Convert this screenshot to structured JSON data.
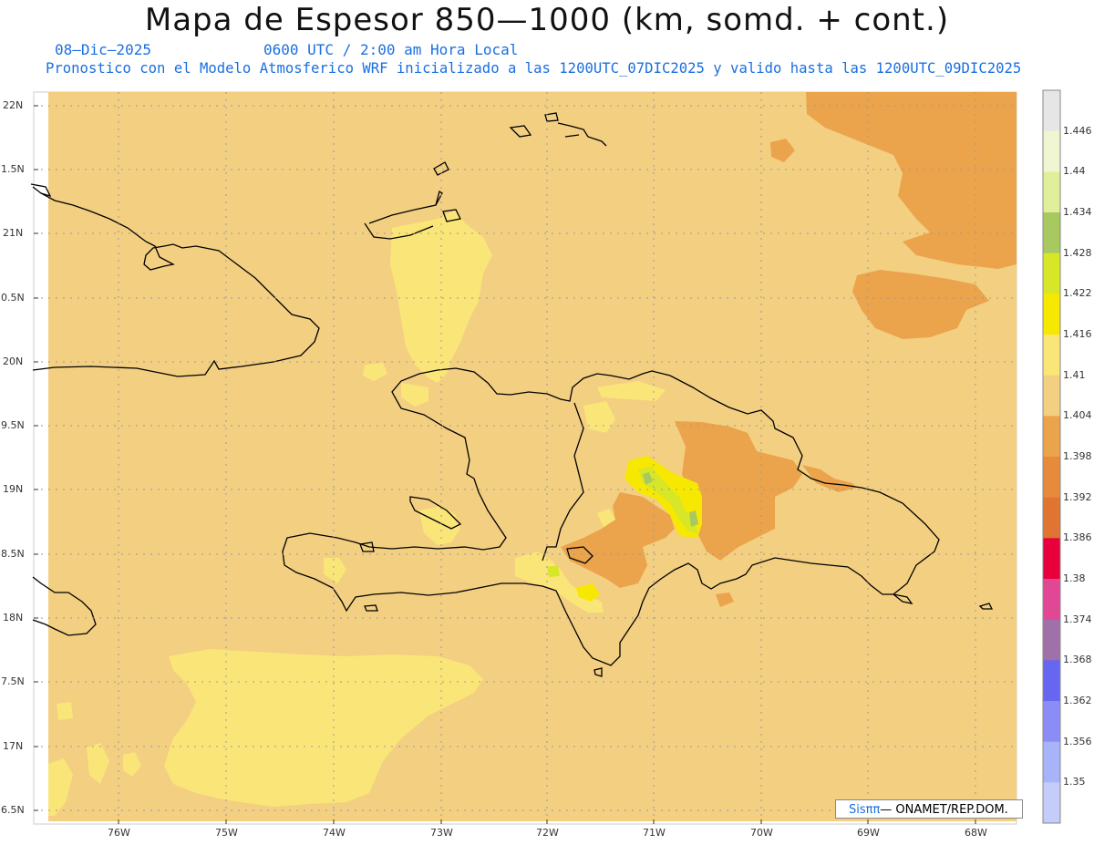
{
  "title": "Mapa de Espesor 850—1000 (km, somd. + cont.)",
  "date": "08—Dic—2025",
  "valid_time": "0600 UTC / 2:00 am Hora Local",
  "description": "Pronostico con el Modelo Atmosferico WRF inicializado a las 1200UTC_07DIC2025 y valido hasta las  1200UTC_09DIC2025",
  "credit": {
    "logo": "Sisππ",
    "text": "— ONAMET/REP.DOM."
  },
  "lat_labels": [
    "22N",
    "1.5N",
    "21N",
    "0.5N",
    "20N",
    "9.5N",
    "19N",
    "8.5N",
    "18N",
    "7.5N",
    "17N",
    "6.5N"
  ],
  "lon_labels": [
    "76W",
    "75W",
    "74W",
    "73W",
    "72W",
    "71W",
    "70W",
    "69W",
    "68W"
  ],
  "colorbar": {
    "labels": [
      "1.446",
      "1.44",
      "1.434",
      "1.428",
      "1.422",
      "1.416",
      "1.41",
      "1.404",
      "1.398",
      "1.392",
      "1.386",
      "1.38",
      "1.374",
      "1.368",
      "1.362",
      "1.356",
      "1.35"
    ],
    "colors": [
      "#e6e6e6",
      "#f0f5d2",
      "#e0f09a",
      "#a8c860",
      "#d8e628",
      "#f6e800",
      "#fae678",
      "#f3cf82",
      "#eba44b",
      "#e68a3c",
      "#e07432",
      "#e8003c",
      "#e04896",
      "#a070a8",
      "#6666f0",
      "#8c8cf6",
      "#a8b4fa",
      "#c4ccfa"
    ]
  },
  "colors": {
    "background_field": "#f3cf82",
    "lower_thickness": "#eba44b",
    "higher_thickness": "#fae678",
    "land_outline": "#000000",
    "subtitle_text": "#1a6fe0"
  }
}
